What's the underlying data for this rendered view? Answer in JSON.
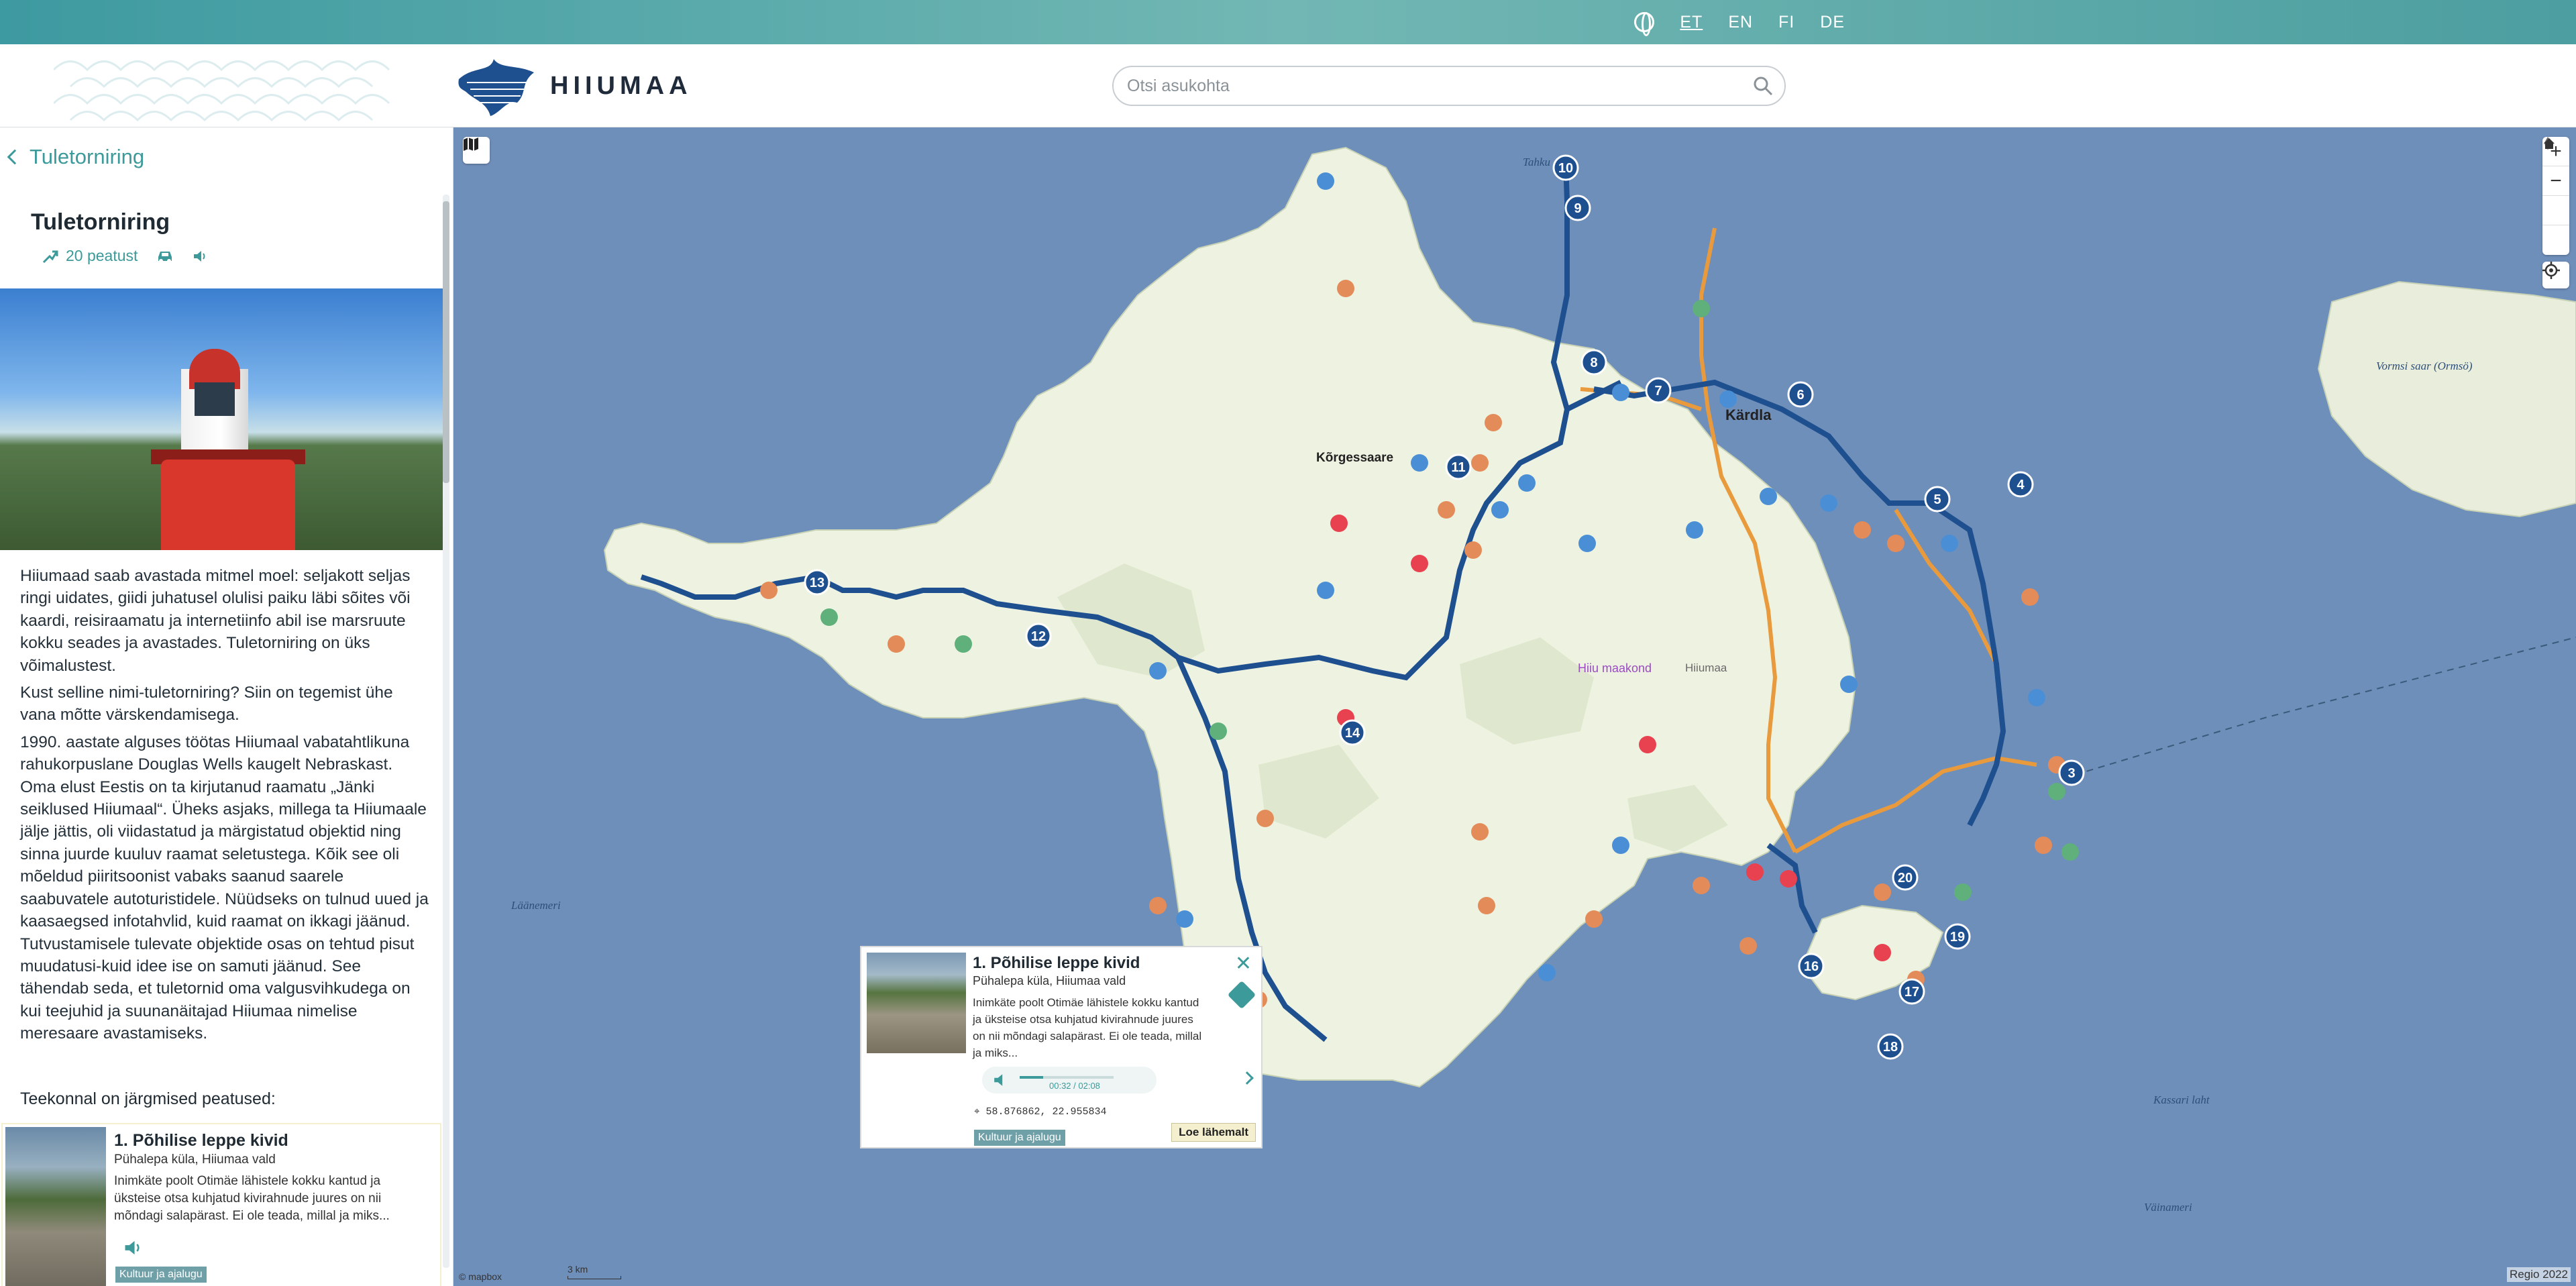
{
  "topbar": {
    "languages": [
      {
        "code": "ET",
        "active": true
      },
      {
        "code": "EN",
        "active": false
      },
      {
        "code": "FI",
        "active": false
      },
      {
        "code": "DE",
        "active": false
      }
    ],
    "globe_icon": "globe-icon"
  },
  "header": {
    "logo_text": "HIIUMAA",
    "search_placeholder": "Otsi asukohta"
  },
  "sidebar": {
    "back_label": "Tuletorniring",
    "route_title": "Tuletorniring",
    "stops_count": "20 peatust",
    "intro": [
      "Hiiumaad saab avastada mitmel moel: seljakott seljas ringi uidates, giidi juhatusel olulisi paiku läbi sõites või kaardi, reisiraamatu ja internetiinfo abil ise marsruute kokku seades ja avastades. Tuletorniring on üks võimalustest.",
      "Kust selline nimi-tuletorniring? Siin on tegemist ühe vana mõtte värskendamisega.",
      "1990. aastate alguses töötas Hiiumaal vabatahtlikuna rahukorpuslane Douglas Wells kaugelt Nebraskast. Oma elust Eestis on ta kirjutanud raamatu „Jänki seiklused Hiiumaal“. Üheks asjaks, millega ta Hiiumaale jälje jättis, oli viidastatud ja märgistatud objektid ning sinna juurde kuuluv raamat seletustega. Kõik see oli mõeldud piiritsoonist vabaks saanud saarele saabuvatele autoturistidele. Nüüdseks on tulnud uued ja kaasaegsed infotahvlid, kuid raamat on ikkagi jäänud. Tutvustamisele tulevate objektide osas on tehtud pisut muudatusi-kuid idee ise on samuti jäänud. See tähendab seda, et tuletornid oma valgusvihkudega on kui teejuhid ja suunanäitajad Hiiumaa nimelise meresaare avastamiseks."
    ],
    "stops_heading": "Teekonnal on järgmised peatused:",
    "stop_card": {
      "title": "1. Põhilise leppe kivid",
      "subtitle": "Pühalepa küla, Hiiumaa vald",
      "text": "Inimkäte poolt Otimäe lähistele kokku kantud ja üksteise otsa kuhjatud kivirahnude juures on nii mõndagi salapärast. Ei ole teada, millal ja miks...",
      "tag": "Kultuur ja ajalugu"
    }
  },
  "map": {
    "labels": [
      {
        "text": "Tahku"
      },
      {
        "text": "Kõrgessaare"
      },
      {
        "text": "Kärdla"
      },
      {
        "text": "Hiiu maakond"
      },
      {
        "text": "Hiiumaa"
      },
      {
        "text": "Läänemeri"
      },
      {
        "text": "Väinameri"
      },
      {
        "text": "Vormsi saar (Ormsö)"
      },
      {
        "text": "Kassari laht"
      }
    ],
    "attribution": "© mapbox",
    "scale": "3 km",
    "copyright": "Regio 2022"
  },
  "popup": {
    "title": "1. Põhilise leppe kivid",
    "subtitle": "Pühalepa küla, Hiiumaa vald",
    "text": "Inimkäte poolt Otimäe lähistele kokku kantud ja üksteise otsa kuhjatud kivirahnude juures on nii mõndagi salapärast. Ei ole teada, millal ja miks...",
    "time": "00:32 / 02:08",
    "progress": 0.25,
    "coords": "58.876862, 22.955834",
    "tag": "Kultuur ja ajalugu",
    "read_more": "Loe lähemalt"
  },
  "colors": {
    "accent": "#3c9a9a",
    "route_blue": "#1e4f8f",
    "sea": "#6f8fbb",
    "land": "#eef3e1"
  }
}
